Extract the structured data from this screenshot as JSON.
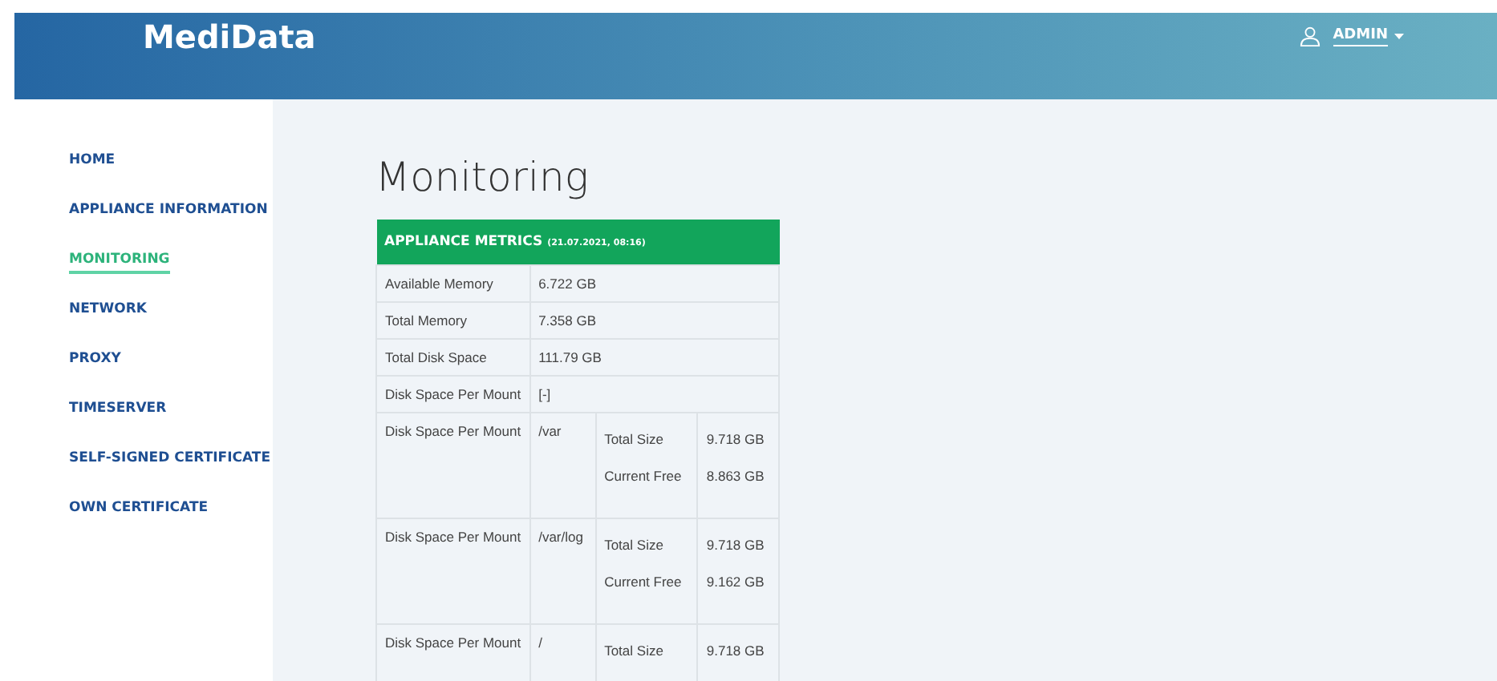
{
  "header": {
    "logo": "MediData",
    "user": "ADMIN"
  },
  "sidebar": {
    "items": [
      {
        "label": "HOME",
        "selected": false
      },
      {
        "label": "APPLIANCE INFORMATION",
        "selected": false
      },
      {
        "label": "MONITORING",
        "selected": true
      },
      {
        "label": "NETWORK",
        "selected": false
      },
      {
        "label": "PROXY",
        "selected": false
      },
      {
        "label": "TIMESERVER",
        "selected": false
      },
      {
        "label": "SELF-SIGNED CERTIFICATE",
        "selected": false
      },
      {
        "label": "OWN CERTIFICATE",
        "selected": false
      }
    ]
  },
  "page_title": "Monitoring",
  "table": {
    "title": "APPLIANCE METRICS",
    "timestamp": "(21.07.2021, 08:16)",
    "rows": [
      {
        "kind": "simple",
        "label": "Available Memory",
        "value": "6.722 GB"
      },
      {
        "kind": "simple",
        "label": "Total Memory",
        "value": "7.358 GB"
      },
      {
        "kind": "simple",
        "label": "Total Disk Space",
        "value": "111.79 GB"
      },
      {
        "kind": "simple",
        "label": "Disk Space Per Mount",
        "value": "[-]"
      },
      {
        "kind": "mount",
        "label": "Disk Space Per Mount",
        "mount": "/var",
        "details": [
          {
            "label": "Total Size",
            "value": "9.718 GB"
          },
          {
            "label": "Current Free",
            "value": "8.863 GB"
          }
        ]
      },
      {
        "kind": "mount",
        "label": "Disk Space Per Mount",
        "mount": "/var/log",
        "details": [
          {
            "label": "Total Size",
            "value": "9.718 GB"
          },
          {
            "label": "Current Free",
            "value": "9.162 GB"
          }
        ]
      },
      {
        "kind": "mount",
        "label": "Disk Space Per Mount",
        "mount": "/",
        "details": [
          {
            "label": "Total Size",
            "value": "9.718 GB"
          }
        ]
      }
    ]
  }
}
